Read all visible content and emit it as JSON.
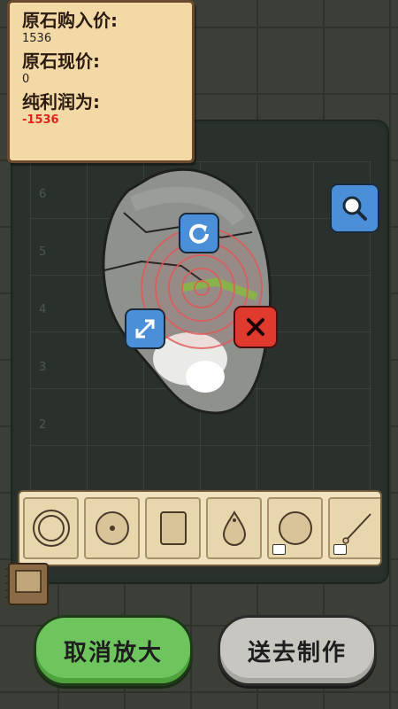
{
  "info": {
    "buy_label": "原石购入价:",
    "buy_value": "1536",
    "current_label": "原石现价:",
    "current_value": "0",
    "profit_label": "纯利润为:",
    "profit_value": "-1536"
  },
  "axis": [
    "6",
    "5",
    "4",
    "3",
    "2"
  ],
  "buttons": {
    "cancel_zoom": "取消放大",
    "send_craft": "送去制作"
  },
  "tray": {
    "items": [
      "bangle-ring",
      "flat-disc",
      "square-tablet",
      "teardrop-pendant",
      "round-bead",
      "carving-tool"
    ]
  },
  "colors": {
    "negative": "#e0231b",
    "green_button": "#6ec55d",
    "grey_button": "#c8c6c0",
    "tool_blue": "#4a8fd8",
    "tool_red": "#e03a2e",
    "jade_vein": "#7ec23f"
  }
}
